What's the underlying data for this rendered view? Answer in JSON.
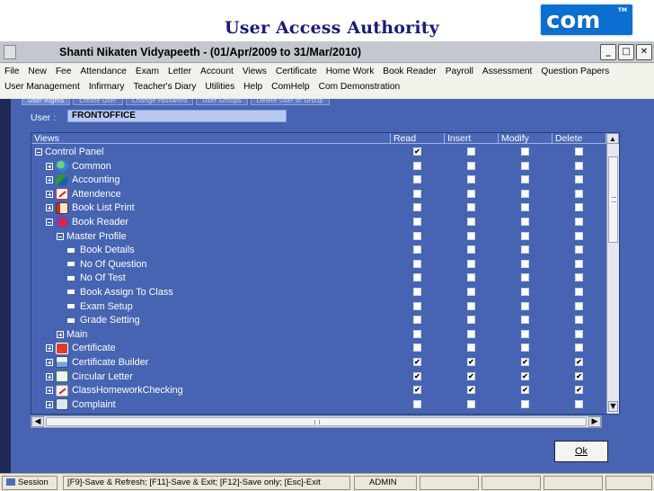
{
  "slide": {
    "heading": "User Access Authority",
    "brand_logo": "com",
    "brand_tm": "TM"
  },
  "window": {
    "title": "Shanti Nikaten Vidyapeeth -   (01/Apr/2009 to 31/Mar/2010)",
    "controls": {
      "minimize": "_",
      "maximize": "□",
      "close": "✕"
    }
  },
  "menu": {
    "row1": [
      "File",
      "New",
      "Fee",
      "Attendance",
      "Exam",
      "Letter",
      "Account",
      "Views",
      "Certificate",
      "Home Work",
      "Book Reader",
      "Payroll",
      "Assessment",
      "Question Papers"
    ],
    "row2": [
      "User Management",
      "Infirmary",
      "Teacher's Diary",
      "Utilities",
      "Help",
      "ComHelp",
      "Com Demonstration"
    ]
  },
  "tabs": [
    "User Rights",
    "Create User",
    "Change Password",
    "User Groups",
    "Delete User or Group"
  ],
  "user": {
    "label": "User :",
    "value": "FRONTOFFICE"
  },
  "grid": {
    "columns": [
      "Views",
      "Read",
      "Insert",
      "Modify",
      "Delete"
    ],
    "rows": [
      {
        "label": "Control Panel",
        "level": 0,
        "toggle": "minus",
        "icon": null,
        "checks": [
          true,
          false,
          false,
          false
        ]
      },
      {
        "label": "Common",
        "level": 1,
        "toggle": "plus",
        "icon": "globe-icon",
        "checks": [
          false,
          false,
          false,
          false
        ]
      },
      {
        "label": "Accounting",
        "level": 1,
        "toggle": "plus",
        "icon": "accounting-icon",
        "checks": [
          false,
          false,
          false,
          false
        ]
      },
      {
        "label": "Attendence",
        "level": 1,
        "toggle": "plus",
        "icon": "attendance-icon",
        "checks": [
          false,
          false,
          false,
          false
        ]
      },
      {
        "label": "Book List Print",
        "level": 1,
        "toggle": "plus",
        "icon": "book-list-icon",
        "checks": [
          false,
          false,
          false,
          false
        ]
      },
      {
        "label": "Book Reader",
        "level": 1,
        "toggle": "minus",
        "icon": "book-reader-icon",
        "checks": [
          false,
          false,
          false,
          false
        ]
      },
      {
        "label": "Master Profile",
        "level": 2,
        "toggle": "minus",
        "icon": null,
        "checks": [
          false,
          false,
          false,
          false
        ]
      },
      {
        "label": "Book Details",
        "level": 3,
        "toggle": "leaf",
        "icon": null,
        "checks": [
          false,
          false,
          false,
          false
        ]
      },
      {
        "label": "No Of Question",
        "level": 3,
        "toggle": "leaf",
        "icon": null,
        "checks": [
          false,
          false,
          false,
          false
        ]
      },
      {
        "label": "No Of Test",
        "level": 3,
        "toggle": "leaf",
        "icon": null,
        "checks": [
          false,
          false,
          false,
          false
        ]
      },
      {
        "label": "Book Assign To Class",
        "level": 3,
        "toggle": "leaf",
        "icon": null,
        "checks": [
          false,
          false,
          false,
          false
        ]
      },
      {
        "label": "Exam Setup",
        "level": 3,
        "toggle": "leaf",
        "icon": null,
        "checks": [
          false,
          false,
          false,
          false
        ]
      },
      {
        "label": "Grade Setting",
        "level": 3,
        "toggle": "leaf",
        "icon": null,
        "checks": [
          false,
          false,
          false,
          false
        ]
      },
      {
        "label": "Main",
        "level": 2,
        "toggle": "plus",
        "icon": null,
        "checks": [
          false,
          false,
          false,
          false
        ]
      },
      {
        "label": "Certificate",
        "level": 1,
        "toggle": "plus",
        "icon": "certificate-icon",
        "checks": [
          false,
          false,
          false,
          false
        ]
      },
      {
        "label": "Certificate Builder",
        "level": 1,
        "toggle": "plus",
        "icon": "certificate-builder-icon",
        "checks": [
          true,
          true,
          true,
          true
        ]
      },
      {
        "label": "Circular Letter",
        "level": 1,
        "toggle": "plus",
        "icon": "circular-letter-icon",
        "checks": [
          true,
          true,
          true,
          true
        ]
      },
      {
        "label": "ClassHomeworkChecking",
        "level": 1,
        "toggle": "plus",
        "icon": "class-homework-icon",
        "checks": [
          true,
          true,
          true,
          true
        ]
      },
      {
        "label": "Complaint",
        "level": 1,
        "toggle": "plus",
        "icon": "complaint-icon",
        "checks": [
          false,
          false,
          false,
          false
        ]
      }
    ],
    "check_glyph": "✔",
    "scroll_up": "▲",
    "scroll_down": "▼",
    "scroll_left": "◀",
    "scroll_right": "▶"
  },
  "ok_button": "Ok",
  "statusbar": {
    "session": "Session",
    "keys": "[F9]-Save & Refresh; [F11]-Save & Exit; [F12]-Save only; [Esc]-Exit",
    "user": "ADMIN"
  },
  "colors": {
    "form_background": "#4664b2",
    "heading": "#1a1a7a",
    "brand": "#0a6fd0"
  }
}
